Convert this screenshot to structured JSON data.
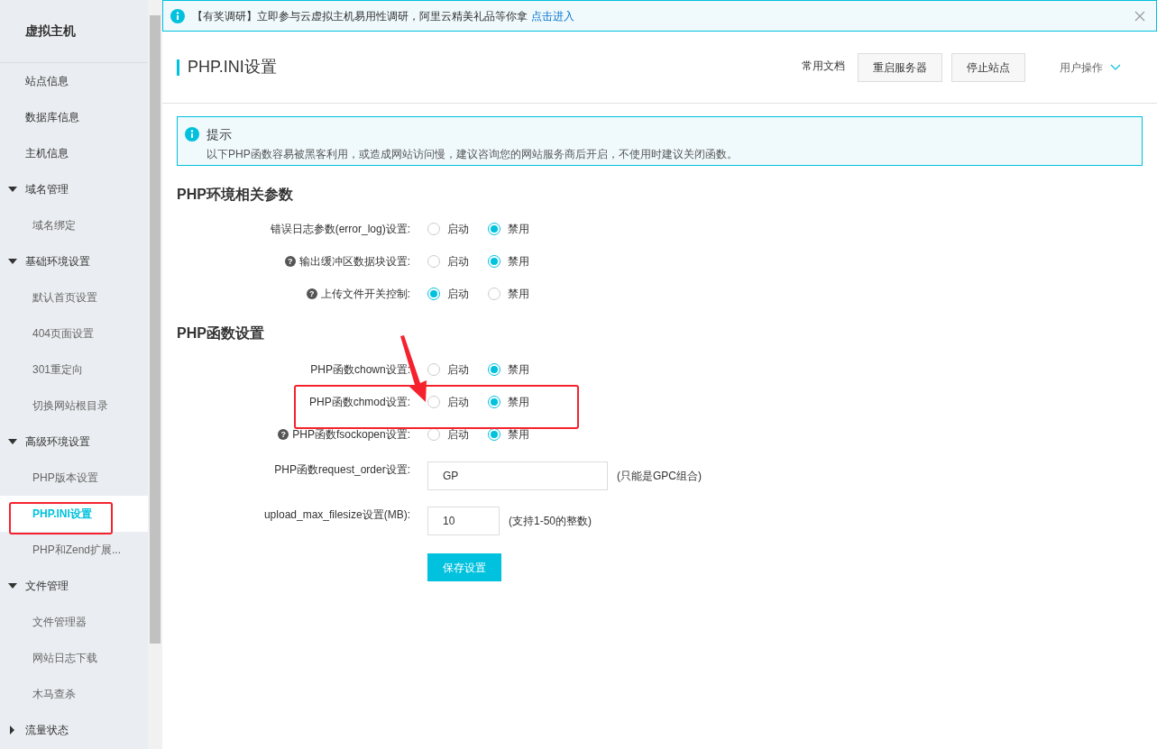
{
  "sidebar": {
    "title": "虚拟主机",
    "items": [
      {
        "label": "站点信息",
        "selected": false
      },
      {
        "label": "数据库信息",
        "selected": false
      },
      {
        "label": "主机信息",
        "selected": false
      },
      {
        "label": "域名管理",
        "expanded": true,
        "children": [
          {
            "label": "域名绑定",
            "selected": false
          }
        ]
      },
      {
        "label": "基础环境设置",
        "expanded": true,
        "children": [
          {
            "label": "默认首页设置",
            "selected": false
          },
          {
            "label": "404页面设置",
            "selected": false
          },
          {
            "label": "301重定向",
            "selected": false
          },
          {
            "label": "切换网站根目录",
            "selected": false
          }
        ]
      },
      {
        "label": "高级环境设置",
        "expanded": true,
        "children": [
          {
            "label": "PHP版本设置",
            "selected": false
          },
          {
            "label": "PHP.INI设置",
            "selected": true
          },
          {
            "label": "PHP和Zend扩展...",
            "selected": false
          }
        ]
      },
      {
        "label": "文件管理",
        "expanded": true,
        "children": [
          {
            "label": "文件管理器",
            "selected": false
          },
          {
            "label": "网站日志下载",
            "selected": false
          },
          {
            "label": "木马查杀",
            "selected": false
          }
        ]
      },
      {
        "label": "流量状态",
        "expanded": false
      }
    ]
  },
  "banner": {
    "text": "【有奖调研】立即参与云虚拟主机易用性调研，阿里云精美礼品等你拿",
    "link": "点击进入"
  },
  "header": {
    "title": "PHP.INI设置",
    "docs_link": "常用文档",
    "buttons": [
      "重启服务器",
      "停止站点"
    ],
    "user_menu": "用户操作"
  },
  "tip": {
    "title": "提示",
    "text": "以下PHP函数容易被黑客利用，或造成网站访问慢，建议咨询您的网站服务商后开启，不使用时建议关闭函数。"
  },
  "sections": [
    {
      "title": "PHP环境相关参数",
      "rows": [
        {
          "kind": "radio",
          "label": "错误日志参数(error_log)设置:",
          "options": [
            {
              "label": "启动",
              "selected": false
            },
            {
              "label": "禁用",
              "selected": true
            }
          ]
        },
        {
          "kind": "radio",
          "label": "输出缓冲区数据块设置:",
          "help": "?",
          "options": [
            {
              "label": "启动",
              "selected": false
            },
            {
              "label": "禁用",
              "selected": true
            }
          ]
        },
        {
          "kind": "radio",
          "label": "上传文件开关控制:",
          "help": "?",
          "options": [
            {
              "label": "启动",
              "selected": true
            },
            {
              "label": "禁用",
              "selected": false
            }
          ]
        }
      ]
    },
    {
      "title": "PHP函数设置",
      "rows": [
        {
          "kind": "radio",
          "label": "PHP函数chown设置:",
          "options": [
            {
              "label": "启动",
              "selected": false
            },
            {
              "label": "禁用",
              "selected": true
            }
          ]
        },
        {
          "kind": "radio",
          "label": "PHP函数chmod设置:",
          "options": [
            {
              "label": "启动",
              "selected": false
            },
            {
              "label": "禁用",
              "selected": true
            }
          ]
        },
        {
          "kind": "radio",
          "label": "PHP函数fsockopen设置:",
          "help": "?",
          "options": [
            {
              "label": "启动",
              "selected": false
            },
            {
              "label": "禁用",
              "selected": true
            }
          ]
        },
        {
          "kind": "wide_input",
          "label": "PHP函数request_order设置:",
          "value": "GP",
          "hint": "(只能是GPC组合)"
        },
        {
          "kind": "short_input",
          "label": "upload_max_filesize设置(MB):",
          "value": "10",
          "hint": "(支持1-50的整数)"
        },
        {
          "kind": "button",
          "label": "保存设置"
        }
      ]
    }
  ]
}
